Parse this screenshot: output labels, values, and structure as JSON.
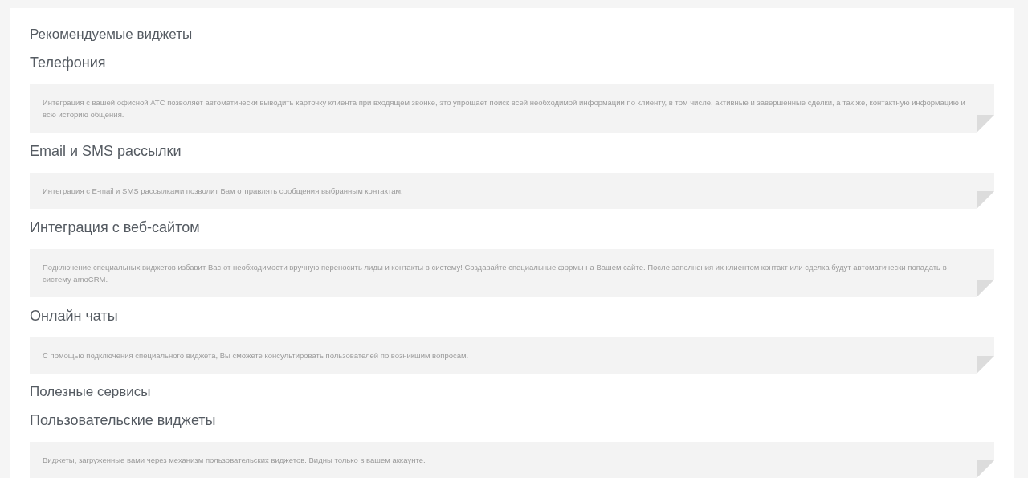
{
  "sections": [
    {
      "kind": "group",
      "title": "Рекомендуемые виджеты"
    },
    {
      "kind": "category",
      "title": "Телефония",
      "description": "Интеграция с вашей офисной АТС позволяет автоматически выводить карточку клиента при входящем звонке, это упрощает поиск всей необходимой информации по клиенту, в том числе, активные и завершенные сделки, а так же, контактную информацию и всю историю общения."
    },
    {
      "kind": "category",
      "title": "Email и SMS рассылки",
      "description": "Интеграция с E-mail и SMS рассылками позволит Вам отправлять сообщения выбранным контактам."
    },
    {
      "kind": "category",
      "title": "Интеграция с веб-сайтом",
      "description": "Подключение специальных виджетов избавит Вас от необходимости вручную переносить лиды и контакты в систему! Создавайте специальные формы на Вашем сайте. После заполнения их клиентом контакт или сделка будут автоматически попадать в систему amoCRM."
    },
    {
      "kind": "category",
      "title": "Онлайн чаты",
      "description": "С помощью подключения специального виджета, Вы сможете консультировать пользователей по возникшим вопросам."
    },
    {
      "kind": "group",
      "title": "Полезные сервисы"
    },
    {
      "kind": "category",
      "title": "Пользовательские виджеты",
      "description": "Виджеты, загруженные вами через механизм пользовательских виджетов. Видны только в вашем аккаунте."
    }
  ]
}
